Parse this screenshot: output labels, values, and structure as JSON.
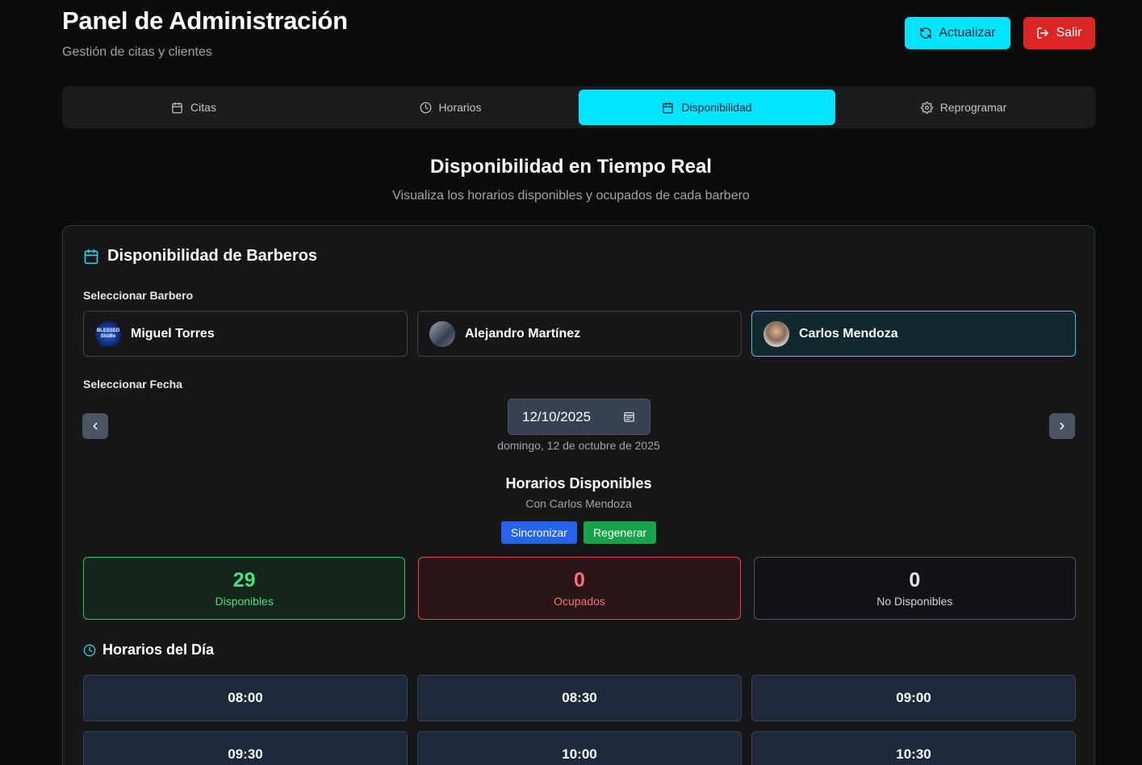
{
  "header": {
    "title": "Panel de Administración",
    "subtitle": "Gestión de citas y clientes",
    "refresh_label": "Actualizar",
    "exit_label": "Salir"
  },
  "tabs": [
    {
      "label": "Citas",
      "icon": "calendar-icon",
      "active": false
    },
    {
      "label": "Horarios",
      "icon": "clock-icon",
      "active": false
    },
    {
      "label": "Disponibilidad",
      "icon": "calendar-icon",
      "active": true
    },
    {
      "label": "Reprogramar",
      "icon": "gear-icon",
      "active": false
    }
  ],
  "section": {
    "title": "Disponibilidad en Tiempo Real",
    "subtitle": "Visualiza los horarios disponibles y ocupados de cada barbero"
  },
  "card": {
    "title": "Disponibilidad de Barberos",
    "barber_label": "Seleccionar Barbero",
    "barbers": [
      {
        "name": "Miguel Torres",
        "avatar_text": "BLESSED Studio",
        "selected": false
      },
      {
        "name": "Alejandro Martínez",
        "selected": false
      },
      {
        "name": "Carlos Mendoza",
        "selected": true
      }
    ],
    "date_label": "Seleccionar Fecha",
    "date_value": "12/10/2025",
    "date_long": "domingo, 12 de octubre de 2025",
    "slots_title": "Horarios Disponibles",
    "slots_subtitle": "Con Carlos Mendoza",
    "sync_label": "Sincronizar",
    "regen_label": "Regenerar",
    "stats": {
      "available": {
        "value": "29",
        "label": "Disponibles"
      },
      "occupied": {
        "value": "0",
        "label": "Ocupados"
      },
      "unavailable": {
        "value": "0",
        "label": "No Disponibles"
      }
    },
    "day_title": "Horarios del Día",
    "slots": [
      "08:00",
      "08:30",
      "09:00",
      "09:30",
      "10:00",
      "10:30"
    ]
  },
  "colors": {
    "accent": "#00e5ff",
    "danger": "#dc2626",
    "sync": "#2563eb",
    "regen": "#16a34a"
  }
}
